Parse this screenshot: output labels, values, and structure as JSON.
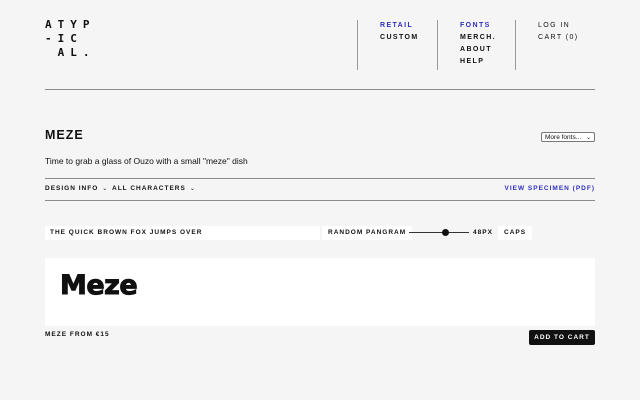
{
  "logo": {
    "lines": [
      "ATYP",
      "-IC",
      " AL."
    ]
  },
  "nav": {
    "col1": [
      "RETAIL",
      "CUSTOM"
    ],
    "col2": [
      "FONTS",
      "MERCH.",
      "ABOUT",
      "HELP"
    ],
    "col3": [
      "LOG IN",
      "CART (0)"
    ],
    "accent": "#2f2fbf"
  },
  "font": {
    "title": "MEZE",
    "select_label": "More fonts...",
    "description": "Time to grab a glass of Ouzo with a small \"meze\" dish",
    "design_info": "DESIGN INFO",
    "all_characters": "ALL CHARACTERS",
    "view_specimen": "VIEW SPECIMEN (PDF)"
  },
  "tester": {
    "sample_text": "THE QUICK BROWN FOX JUMPS OVER",
    "random_pangram": "RANDOM PANGRAM",
    "size_value": "48PX",
    "caps_label": "CAPS",
    "size_level": 0.55
  },
  "preview": {
    "text": "Meze"
  },
  "footer": {
    "price": "MEZE FROM €15",
    "add_to_cart": "ADD TO CART"
  }
}
